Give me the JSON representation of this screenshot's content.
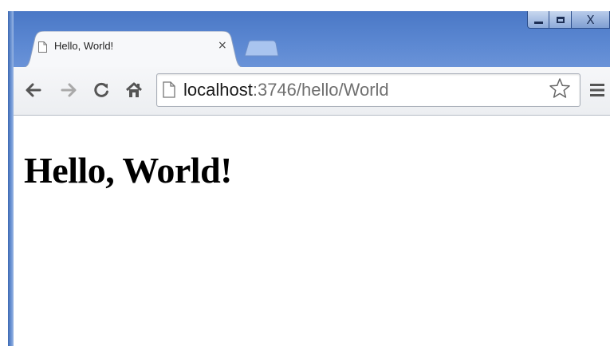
{
  "window": {
    "controls": [
      "minimize",
      "maximize",
      "close"
    ],
    "close_label": "X",
    "colors": {
      "frame": "#5a86d0",
      "tab_bg": "#f7f8fa"
    }
  },
  "tabs": [
    {
      "title": "Hello, World!",
      "close_label": "×",
      "icon": "page-icon",
      "active": true
    }
  ],
  "new_tab": {
    "icon": "new-tab-icon"
  },
  "toolbar": {
    "back_icon": "back-arrow-icon",
    "forward_icon": "forward-arrow-icon",
    "reload_icon": "reload-icon",
    "home_icon": "home-icon",
    "url_host": "localhost",
    "url_path": ":3746/hello/World",
    "bookmark_icon": "star-icon",
    "menu_icon": "menu-icon"
  },
  "page": {
    "heading": "Hello, World!"
  }
}
